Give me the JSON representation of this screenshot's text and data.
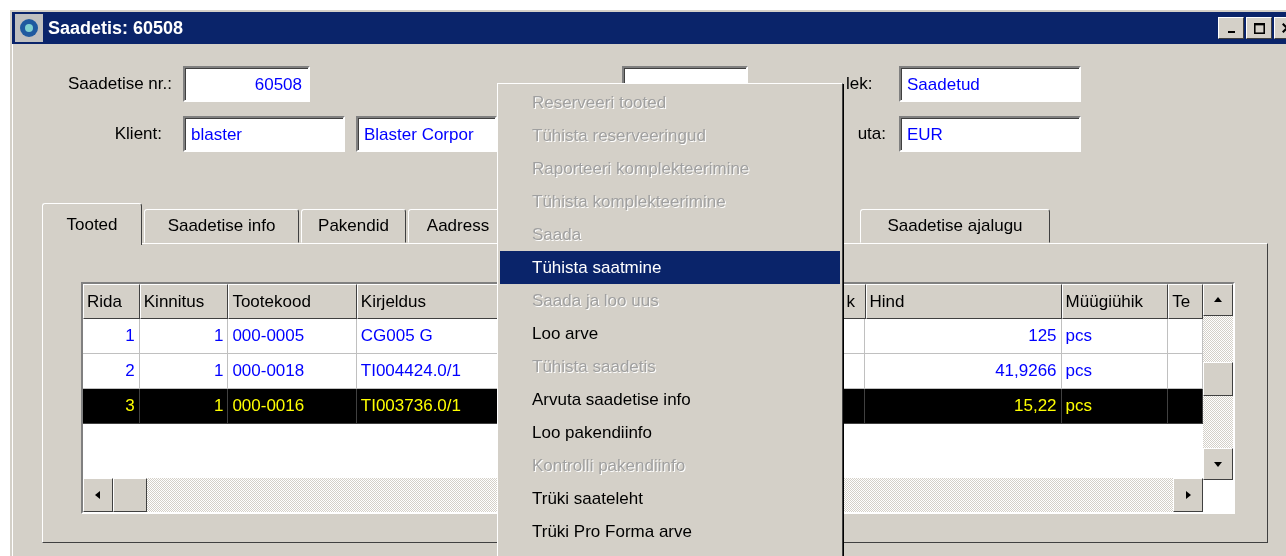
{
  "window": {
    "title": "Saadetis: 60508"
  },
  "form": {
    "rows": [
      {
        "fields": [
          {
            "label": "Saadetise nr.:",
            "value": "60508"
          },
          {
            "label": "lek:",
            "value": "Saadetud"
          }
        ]
      },
      {
        "fields": [
          {
            "label": "Klient:",
            "value": "blaster"
          },
          {
            "value": "Blaster Corpor"
          },
          {
            "label": "uta:",
            "value": "EUR"
          }
        ]
      }
    ]
  },
  "tabs": [
    {
      "label": "Tooted",
      "selected": true
    },
    {
      "label": "Saadetise info",
      "selected": false
    },
    {
      "label": "Pakendid",
      "selected": false
    },
    {
      "label": "Aadress",
      "selected": false
    },
    {
      "label": "Saadetise ajalugu",
      "selected": false
    }
  ],
  "table": {
    "columns": [
      "Rida",
      "Kinnitus",
      "Tootekood",
      "Kirjeldus",
      "k",
      "Hind",
      "Müügiühik",
      "Te"
    ],
    "rows": [
      {
        "selected": false,
        "cells": [
          "1",
          "1",
          "000-0005",
          "CG005 G",
          "",
          "125",
          "pcs",
          ""
        ]
      },
      {
        "selected": false,
        "cells": [
          "2",
          "1",
          "000-0018",
          "TI004424.0/1",
          "",
          "41,9266",
          "pcs",
          ""
        ]
      },
      {
        "selected": true,
        "cells": [
          "3",
          "1",
          "000-0016",
          "TI003736.0/1",
          "",
          "15,22",
          "pcs",
          ""
        ]
      }
    ]
  },
  "context_menu": {
    "items": [
      {
        "label": "Reserveeri tooted",
        "disabled": true,
        "selected": false
      },
      {
        "label": "Tühista reserveeringud",
        "disabled": true,
        "selected": false
      },
      {
        "label": "Raporteeri komplekteerimine",
        "disabled": true,
        "selected": false
      },
      {
        "label": "Tühista komplekteerimine",
        "disabled": true,
        "selected": false
      },
      {
        "label": "Saada",
        "disabled": true,
        "selected": false
      },
      {
        "label": "Tühista saatmine",
        "disabled": false,
        "selected": true
      },
      {
        "label": "Saada ja loo uus",
        "disabled": true,
        "selected": false
      },
      {
        "label": "Loo arve",
        "disabled": false,
        "selected": false
      },
      {
        "label": "Tühista saadetis",
        "disabled": true,
        "selected": false
      },
      {
        "label": "Arvuta saadetise info",
        "disabled": false,
        "selected": false
      },
      {
        "label": "Loo pakendiinfo",
        "disabled": false,
        "selected": false
      },
      {
        "label": "Kontrolli pakendiinfo",
        "disabled": true,
        "selected": false
      },
      {
        "label": "Trüki saateleht",
        "disabled": false,
        "selected": false
      },
      {
        "label": "Trüki Pro Forma arve",
        "disabled": false,
        "selected": false
      }
    ]
  }
}
